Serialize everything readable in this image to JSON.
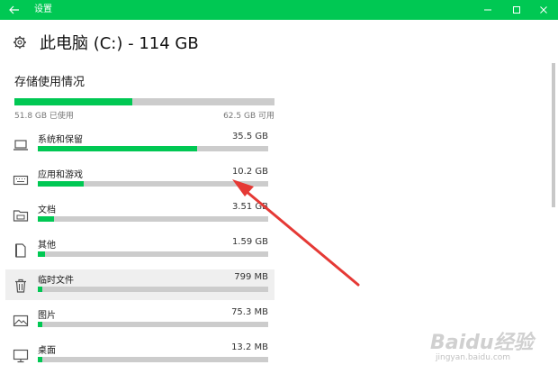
{
  "titlebar": {
    "title": "设置"
  },
  "header": {
    "title": "此电脑 (C:) - 114 GB"
  },
  "storage": {
    "section_title": "存储使用情况",
    "used_label": "51.8 GB 已使用",
    "available_label": "62.5 GB 可用",
    "used_fraction": 0.453
  },
  "categories": [
    {
      "name": "系统和保留",
      "size": "35.5 GB",
      "fraction": 0.69,
      "icon": "laptop-icon"
    },
    {
      "name": "应用和游戏",
      "size": "10.2 GB",
      "fraction": 0.2,
      "icon": "keyboard-icon"
    },
    {
      "name": "文档",
      "size": "3.51 GB",
      "fraction": 0.07,
      "icon": "folder-icon"
    },
    {
      "name": "其他",
      "size": "1.59 GB",
      "fraction": 0.03,
      "icon": "document-icon"
    },
    {
      "name": "临时文件",
      "size": "799 MB",
      "fraction": 0.015,
      "icon": "trash-icon"
    },
    {
      "name": "图片",
      "size": "75.3 MB",
      "fraction": 0.003,
      "icon": "image-icon"
    },
    {
      "name": "桌面",
      "size": "13.2 MB",
      "fraction": 0.002,
      "icon": "monitor-icon"
    }
  ],
  "watermark": {
    "text": "Baidu经验",
    "sub": "jingyan.baidu.com"
  },
  "colors": {
    "accent": "#00c853",
    "bar_track": "#cccccc",
    "annotation_arrow": "#e53935"
  }
}
